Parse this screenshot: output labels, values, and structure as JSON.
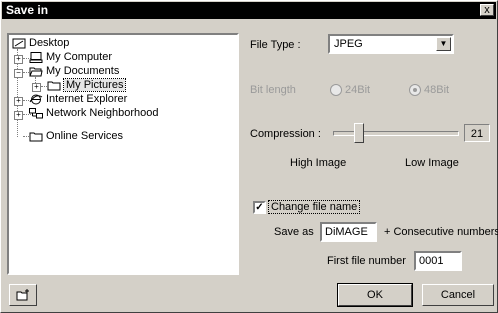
{
  "window": {
    "title": "Save in",
    "close_glyph": "x"
  },
  "tree": {
    "items": [
      {
        "label": "Desktop",
        "icon": "desktop-icon"
      },
      {
        "label": "My Computer",
        "icon": "computer-icon"
      },
      {
        "label": "My Documents",
        "icon": "folder-open-icon"
      },
      {
        "label": "My Pictures",
        "icon": "folder-icon"
      },
      {
        "label": "Internet Explorer",
        "icon": "internet-explorer-icon"
      },
      {
        "label": "Network Neighborhood",
        "icon": "network-icon"
      },
      {
        "label": "Online Services",
        "icon": "folder-icon"
      }
    ]
  },
  "file_type": {
    "label": "File Type :",
    "value": "JPEG"
  },
  "bit_length": {
    "label": "Bit length",
    "option1": "24Bit",
    "option2": "48Bit",
    "selected": "48Bit"
  },
  "compression": {
    "label": "Compression :",
    "value": "21",
    "low_label": "High Image",
    "high_label": "Low Image"
  },
  "change_name": {
    "label": "Change file name",
    "checked": true,
    "check_glyph": "✓"
  },
  "save_as": {
    "label": "Save as",
    "value": "DiMAGE",
    "suffix": "+ Consecutive numbers"
  },
  "first_number": {
    "label": "First file number",
    "value": "0001"
  },
  "buttons": {
    "ok": "OK",
    "cancel": "Cancel"
  }
}
